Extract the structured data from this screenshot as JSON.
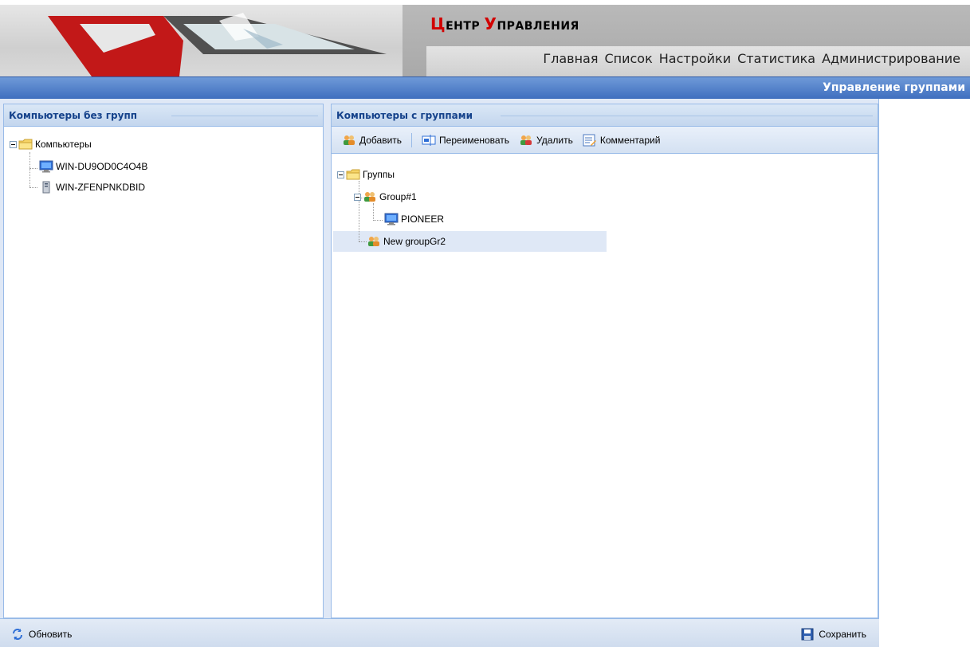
{
  "header": {
    "title_cap1": "Ц",
    "title_rest1": "ЕНТР ",
    "title_cap2": "У",
    "title_rest2": "ПРАВЛЕНИЯ",
    "nav": [
      "Главная",
      "Список",
      "Настройки",
      "Статистика",
      "Администрирование"
    ],
    "page_heading": "Управление группами"
  },
  "left_panel": {
    "title": "Компьютеры без групп",
    "tree": {
      "root": "Компьютеры",
      "children": [
        "WIN-DU9OD0C4O4B",
        "WIN-ZFENPNKDBID"
      ]
    }
  },
  "right_panel": {
    "title": "Компьютеры с группами",
    "toolbar": {
      "add": "Добавить",
      "rename": "Переименовать",
      "delete": "Удалить",
      "comment": "Комментарий"
    },
    "tree": {
      "root": "Группы",
      "group1": "Group#1",
      "group1_child": "PIONEER",
      "group2": "New groupGr2"
    }
  },
  "footer": {
    "refresh": "Обновить",
    "save": "Сохранить"
  },
  "colors": {
    "accent_blue": "#3f6fbf",
    "panel_border": "#99bbe8",
    "title_red": "#d10000"
  }
}
